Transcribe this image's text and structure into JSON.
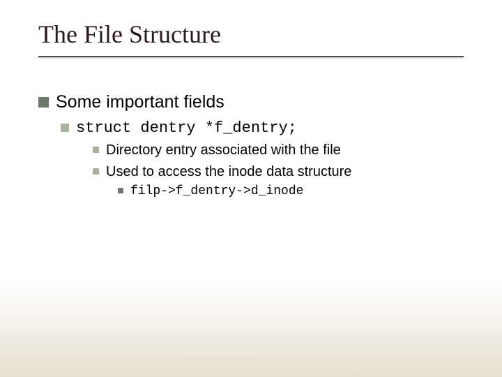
{
  "title": "The File Structure",
  "body": {
    "l1": "Some important fields",
    "l2": "struct dentry *f_dentry;",
    "l3a": "Directory entry associated with the file",
    "l3b": "Used to access the inode data structure",
    "l4": "filp->f_dentry->d_inode"
  }
}
